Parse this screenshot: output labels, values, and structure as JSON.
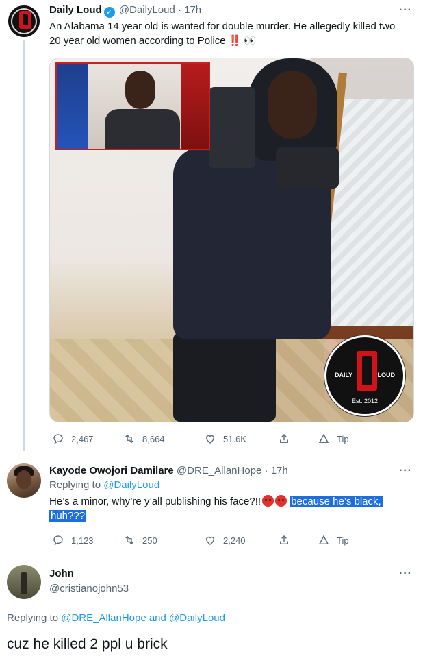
{
  "tweet": {
    "author_name": "Daily Loud",
    "author_handle": "@DailyLoud",
    "time": "· 17h",
    "more": "···",
    "text_line1": "An Alabama 14 year old is wanted for double murder. He allegedly killed two",
    "text_line2": "20 year old women according to Police",
    "bang": "‼️",
    "eyes": "👀",
    "logo_left": "DAILY",
    "logo_right": "LOUD",
    "logo_est": "Est. 2012",
    "stats": {
      "replies": "2,467",
      "retweets": "8,664",
      "likes": "51.6K",
      "tip": "Tip"
    }
  },
  "reply": {
    "author_name": "Kayode Owojori Damilare",
    "author_handle": "@DRE_AllanHope",
    "time": "· 17h",
    "more": "···",
    "replying_label": "Replying to",
    "replying_handle": "@DailyLoud",
    "text": "He’s a minor, why’re y’all publishing his face?!!",
    "highlight_1": "because he’s black,",
    "highlight_2": "huh???",
    "stats": {
      "replies": "1,123",
      "retweets": "250",
      "likes": "2,240",
      "tip": "Tip"
    }
  },
  "reply2": {
    "author_name": "John",
    "author_handle": "@cristianojohn53",
    "more": "···",
    "replying_label": "Replying to",
    "replying_handles": "@DRE_AllanHope and @DailyLoud",
    "text": "cuz he killed 2 ppl u brick"
  },
  "colors": {
    "accent": "#1d9bf0",
    "highlight": "#1d6fe0",
    "muted": "#536471",
    "brand_red": "#d1121a"
  }
}
